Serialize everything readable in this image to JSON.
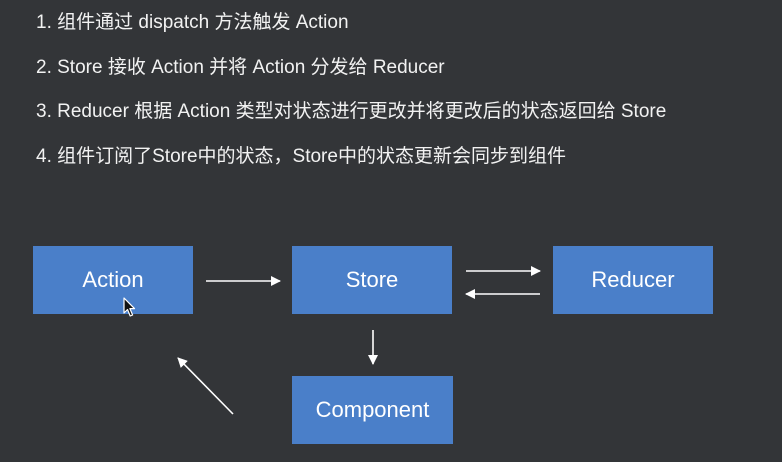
{
  "steps": [
    "1. 组件通过 dispatch 方法触发 Action",
    "2. Store 接收 Action 并将 Action 分发给 Reducer",
    "3. Reducer 根据 Action 类型对状态进行更改并将更改后的状态返回给 Store",
    "4. 组件订阅了Store中的状态，Store中的状态更新会同步到组件"
  ],
  "diagram": {
    "nodes": {
      "action": "Action",
      "store": "Store",
      "reducer": "Reducer",
      "component": "Component"
    },
    "edges": [
      {
        "from": "action",
        "to": "store"
      },
      {
        "from": "store",
        "to": "reducer"
      },
      {
        "from": "reducer",
        "to": "store"
      },
      {
        "from": "store",
        "to": "component"
      },
      {
        "from": "component",
        "to": "action"
      }
    ]
  },
  "colors": {
    "background": "#333538",
    "box_fill": "#4a7fc9",
    "text": "#f2f2f2",
    "arrow": "#ffffff"
  }
}
